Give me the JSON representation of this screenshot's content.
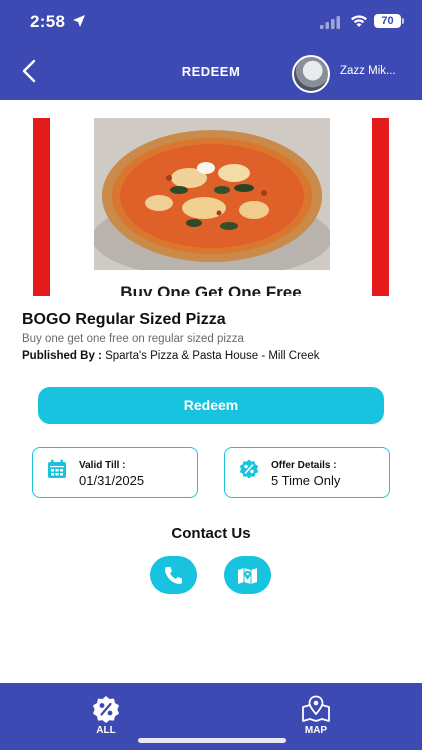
{
  "status_bar": {
    "time": "2:58",
    "battery": "70"
  },
  "header": {
    "back_label": "<",
    "title": "REDEEM",
    "username": "Zazz Mik..."
  },
  "banner": {
    "caption": "Buy One Get One Free",
    "accent_color": "#e31b1b"
  },
  "offer": {
    "title": "BOGO Regular Sized Pizza",
    "description": "Buy one get one free on regular sized pizza",
    "published_label": "Published By :",
    "published_value": "Sparta's Pizza & Pasta House  - Mill Creek"
  },
  "redeem_button": {
    "label": "Redeem"
  },
  "cards": {
    "valid_till_label": "Valid Till :",
    "valid_till_value": "01/31/2025",
    "offer_details_label": "Offer Details :",
    "offer_details_value": "5 Time Only"
  },
  "contact": {
    "title": "Contact Us",
    "buttons": [
      "phone-icon",
      "map-icon"
    ]
  },
  "bottom_nav": {
    "items": [
      {
        "label": "ALL",
        "icon": "percent-badge-icon"
      },
      {
        "label": "MAP",
        "icon": "map-pin-icon"
      }
    ]
  },
  "colors": {
    "primary": "#3d4ab3",
    "accent": "#18c3df",
    "banner_red": "#e31b1b"
  }
}
